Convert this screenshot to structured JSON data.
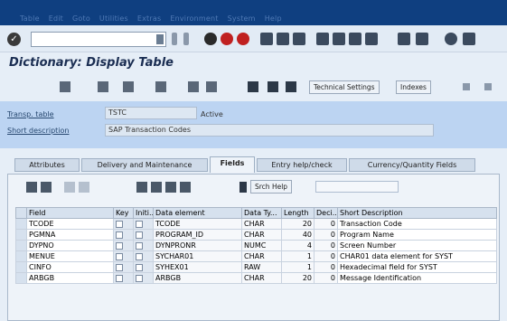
{
  "menu": [
    "Table",
    "Edit",
    "Goto",
    "Utilities",
    "Extras",
    "Environment",
    "System",
    "Help"
  ],
  "title": "Dictionary: Display Table",
  "toolbar": {
    "technical_settings": "Technical Settings",
    "indexes": "Indexes"
  },
  "header": {
    "table_label": "Transp. table",
    "table_value": "TSTC",
    "status_value": "Active",
    "desc_label": "Short description",
    "desc_value": "SAP Transaction Codes"
  },
  "tabs": [
    {
      "label": "Attributes",
      "active": false
    },
    {
      "label": "Delivery and Maintenance",
      "active": false
    },
    {
      "label": "Fields",
      "active": true
    },
    {
      "label": "Entry help/check",
      "active": false
    },
    {
      "label": "Currency/Quantity Fields",
      "active": false
    }
  ],
  "table_toolbar": {
    "srch_help": "Srch Help"
  },
  "columns": [
    "Field",
    "Key",
    "Initi...",
    "Data element",
    "Data Ty...",
    "Length",
    "Deci...",
    "Short Description"
  ],
  "rows": [
    {
      "field": "TCODE",
      "key": true,
      "init": true,
      "elem": "TCODE",
      "type": "CHAR",
      "len": "20",
      "dec": "0",
      "desc": "Transaction Code"
    },
    {
      "field": "PGMNA",
      "key": false,
      "init": true,
      "elem": "PROGRAM_ID",
      "type": "CHAR",
      "len": "40",
      "dec": "0",
      "desc": "Program Name"
    },
    {
      "field": "DYPNO",
      "key": false,
      "init": true,
      "elem": "DYNPRONR",
      "type": "NUMC",
      "len": "4",
      "dec": "0",
      "desc": "Screen Number"
    },
    {
      "field": "MENUE",
      "key": false,
      "init": true,
      "elem": "SYCHAR01",
      "type": "CHAR",
      "len": "1",
      "dec": "0",
      "desc": "CHAR01 data element for SYST"
    },
    {
      "field": "CINFO",
      "key": false,
      "init": true,
      "elem": "SYHEX01",
      "type": "RAW",
      "len": "1",
      "dec": "0",
      "desc": "Hexadecimal field for SYST"
    },
    {
      "field": "ARBGB",
      "key": false,
      "init": true,
      "elem": "ARBGB",
      "type": "CHAR",
      "len": "20",
      "dec": "0",
      "desc": "Message Identification"
    }
  ],
  "colors": {
    "menubar": "#0f3f80",
    "header_panel": "#bcd4f2",
    "background": "#e6eef7"
  }
}
